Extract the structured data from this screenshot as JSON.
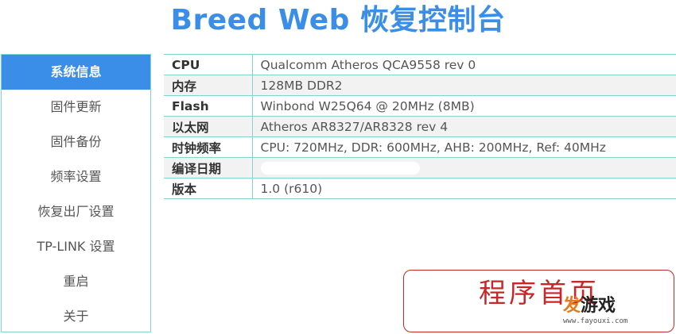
{
  "title": "Breed Web 恢复控制台",
  "sidebar": {
    "items": [
      {
        "label": "系统信息",
        "active": true
      },
      {
        "label": "固件更新"
      },
      {
        "label": "固件备份"
      },
      {
        "label": "频率设置"
      },
      {
        "label": "恢复出厂设置"
      },
      {
        "label": "TP-LINK 设置"
      },
      {
        "label": "重启"
      },
      {
        "label": "关于"
      }
    ]
  },
  "info": {
    "rows": [
      {
        "key": "CPU",
        "value": "Qualcomm Atheros QCA9558 rev 0"
      },
      {
        "key": "内存",
        "value": "128MB DDR2"
      },
      {
        "key": "Flash",
        "value": "Winbond W25Q64 @ 20MHz (8MB)"
      },
      {
        "key": "以太网",
        "value": "Atheros AR8327/AR8328 rev 4"
      },
      {
        "key": "时钟频率",
        "value": "CPU: 720MHz, DDR: 600MHz, AHB: 200MHz, Ref: 40MHz"
      },
      {
        "key": "编译日期",
        "value": ""
      },
      {
        "key": "版本",
        "value": "1.0 (r610)"
      }
    ]
  },
  "promo": {
    "text": "程序首页",
    "logo_part1": "发",
    "logo_part2": "游戏",
    "logo_url": "www.fayouxi.com"
  },
  "colors": {
    "accent": "#3b8ee8",
    "border": "#7fd6d2",
    "promo_red": "#c62828"
  }
}
